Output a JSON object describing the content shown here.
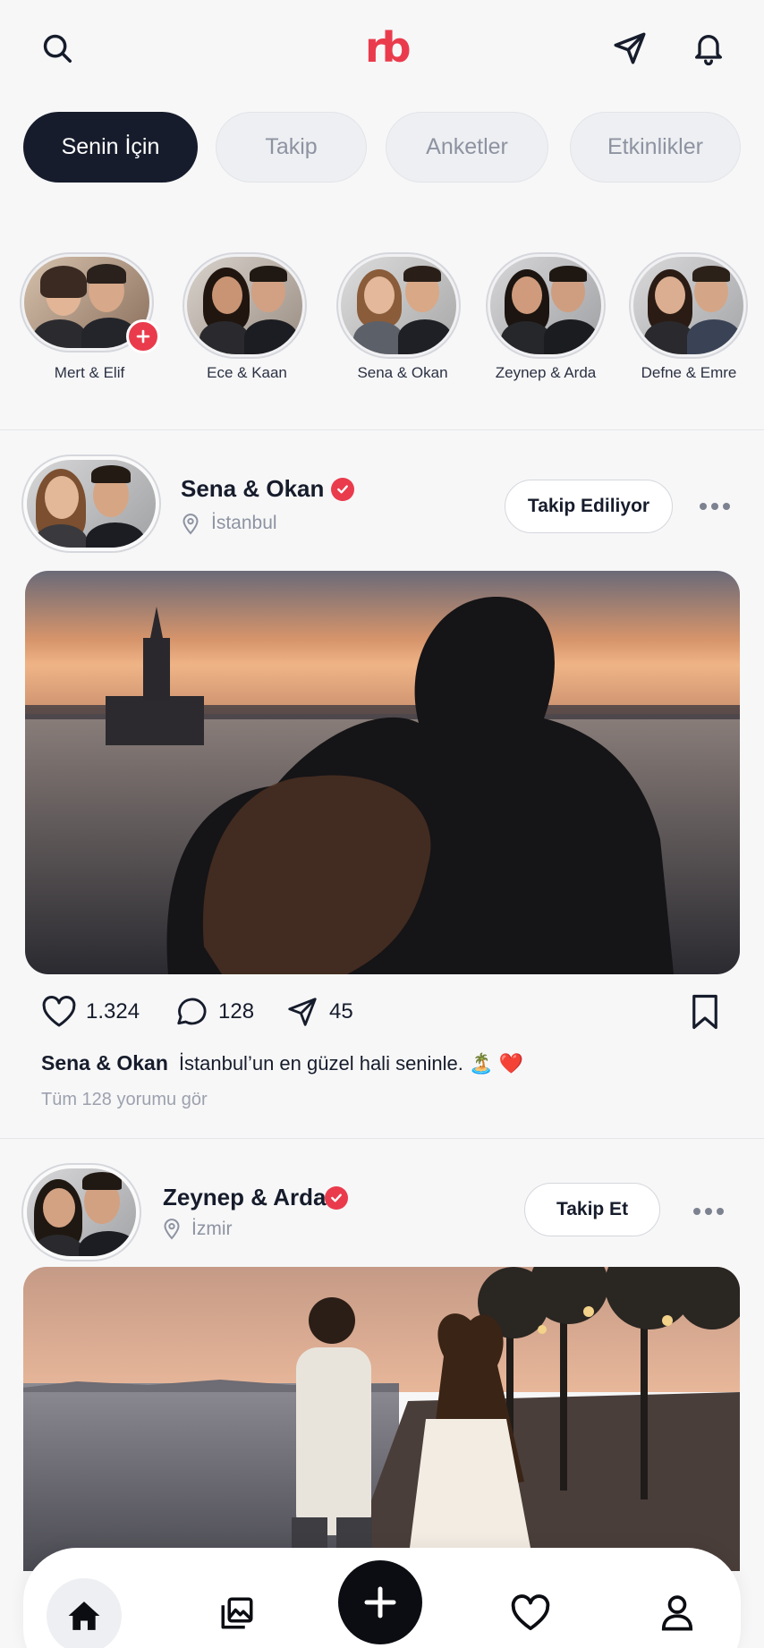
{
  "header": {
    "logo_text": "rb",
    "search_icon": "search-icon",
    "send_icon": "send-icon",
    "bell_icon": "bell-icon"
  },
  "tabs": [
    {
      "label": "Senin İçin",
      "active": true
    },
    {
      "label": "Takip",
      "active": false
    },
    {
      "label": "Anketler",
      "active": false
    },
    {
      "label": "Etkinlikler",
      "active": false
    }
  ],
  "stories": [
    {
      "name": "Mert & Elif",
      "add_badge": true
    },
    {
      "name": "Ece & Kaan"
    },
    {
      "name": "Sena & Okan"
    },
    {
      "name": "Zeynep & Arda"
    },
    {
      "name": "Defne & Emre"
    }
  ],
  "posts": [
    {
      "name": "Sena & Okan",
      "location": "İstanbul",
      "follow_label": "Takip Ediliyor",
      "likes": "1.324",
      "comments": "128",
      "shares": "45",
      "caption_user": "Sena & Okan",
      "caption_text": "İstanbul’un en güzel hali seninle. 🏝️ ❤️",
      "view_comments": "Tüm 128 yorumu gör"
    },
    {
      "name": "Zeynep & Arda",
      "location": "İzmir",
      "follow_label": "Takip Et"
    }
  ],
  "bottom_nav": [
    "home-icon",
    "gallery-icon",
    "plus-icon",
    "heart-icon",
    "profile-icon"
  ],
  "colors": {
    "accent": "#ea3b4c",
    "dark": "#161c2b",
    "muted": "#8d93a1",
    "background": "#f7f7f8"
  }
}
